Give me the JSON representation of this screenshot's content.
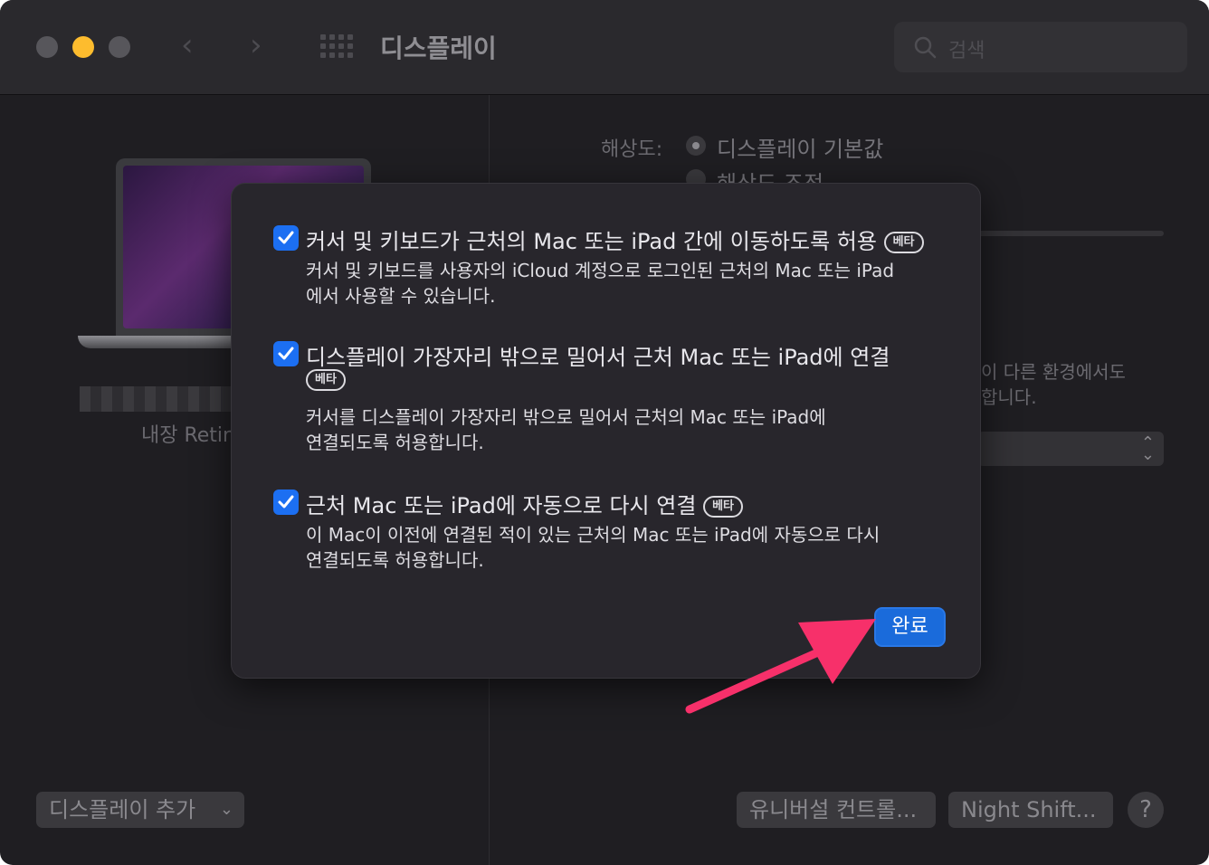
{
  "window": {
    "title": "디스플레이"
  },
  "search": {
    "placeholder": "검색"
  },
  "display": {
    "name": "내장 Retir"
  },
  "resolution": {
    "label": "해상도:",
    "option_default": "디스플레이 기본값",
    "option_scaled": "해상도 조정"
  },
  "side_text": {
    "line1": "이 다른 환경에서도",
    "line2": "합니다."
  },
  "buttons": {
    "add_display": "디스플레이 추가",
    "universal_control": "유니버설 컨트롤...",
    "night_shift": "Night Shift...",
    "help": "?"
  },
  "sheet": {
    "options": [
      {
        "checked": true,
        "title": "커서 및 키보드가 근처의 Mac 또는 iPad 간에 이동하도록 허용",
        "badge": "베타",
        "desc_line1": "커서 및 키보드를 사용자의 iCloud 계정으로 로그인된 근처의 Mac 또는 iPad",
        "desc_line2": "에서 사용할 수 있습니다."
      },
      {
        "checked": true,
        "title": "디스플레이 가장자리 밖으로 밀어서 근처 Mac 또는 iPad에 연결",
        "badge": "베타",
        "desc_line1": "커서를 디스플레이 가장자리 밖으로 밀어서 근처의 Mac 또는 iPad에",
        "desc_line2": "연결되도록 허용합니다."
      },
      {
        "checked": true,
        "title": "근처 Mac 또는 iPad에 자동으로 다시 연결",
        "badge": "베타",
        "desc_line1": "이 Mac이 이전에 연결된 적이 있는 근처의 Mac 또는 iPad에 자동으로 다시",
        "desc_line2": "연결되도록 허용합니다."
      }
    ],
    "done_label": "완료"
  },
  "colors": {
    "accent": "#1a6bdb",
    "checkbox": "#1c6ff2",
    "annotation_arrow": "#f7306a",
    "traffic_min": "#fdbc2e"
  }
}
